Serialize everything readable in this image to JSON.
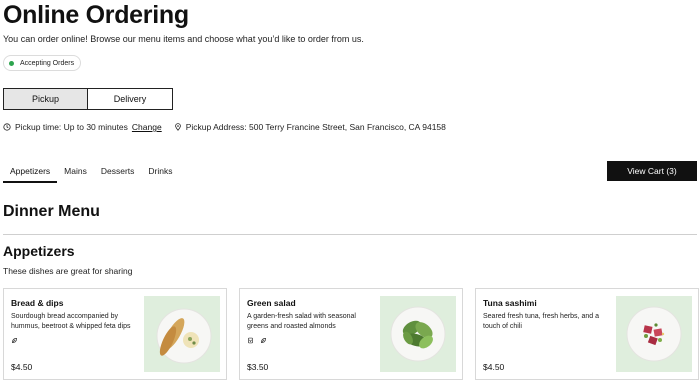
{
  "header": {
    "title": "Online Ordering",
    "intro": "You can order online! Browse our menu items and choose what you’d like to order from us.",
    "status": "Accepting Orders",
    "status_color": "#2da44e"
  },
  "fulfillment": {
    "options": [
      "Pickup",
      "Delivery"
    ],
    "selected": "Pickup"
  },
  "pickup_info": {
    "time_text": "Pickup time: Up to 30 minutes",
    "change_label": "Change",
    "address_text": "Pickup Address: 500 Terry Francine Street, San Francisco, CA 94158"
  },
  "tabs": {
    "items": [
      "Appetizers",
      "Mains",
      "Desserts",
      "Drinks"
    ],
    "active": "Appetizers"
  },
  "cart": {
    "label": "View Cart (3)"
  },
  "menu": {
    "title": "Dinner Menu",
    "section": {
      "title": "Appetizers",
      "subtitle": "These dishes are great for sharing",
      "items": [
        {
          "name": "Bread & dips",
          "description": "Sourdough bread accompanied by hummus, beetroot & whipped feta dips",
          "price": "$4.50",
          "icons": [
            "leaf-icon"
          ]
        },
        {
          "name": "Green salad",
          "description": "A garden-fresh salad with seasonal greens and roasted almonds",
          "price": "$3.50",
          "icons": [
            "vegan-icon",
            "leaf-icon"
          ]
        },
        {
          "name": "Tuna sashimi",
          "description": "Seared fresh tuna, fresh herbs, and a touch of chili",
          "price": "$4.50",
          "icons": []
        }
      ]
    }
  },
  "colors": {
    "accent": "#111111",
    "image_bg": "#dfeedd"
  }
}
